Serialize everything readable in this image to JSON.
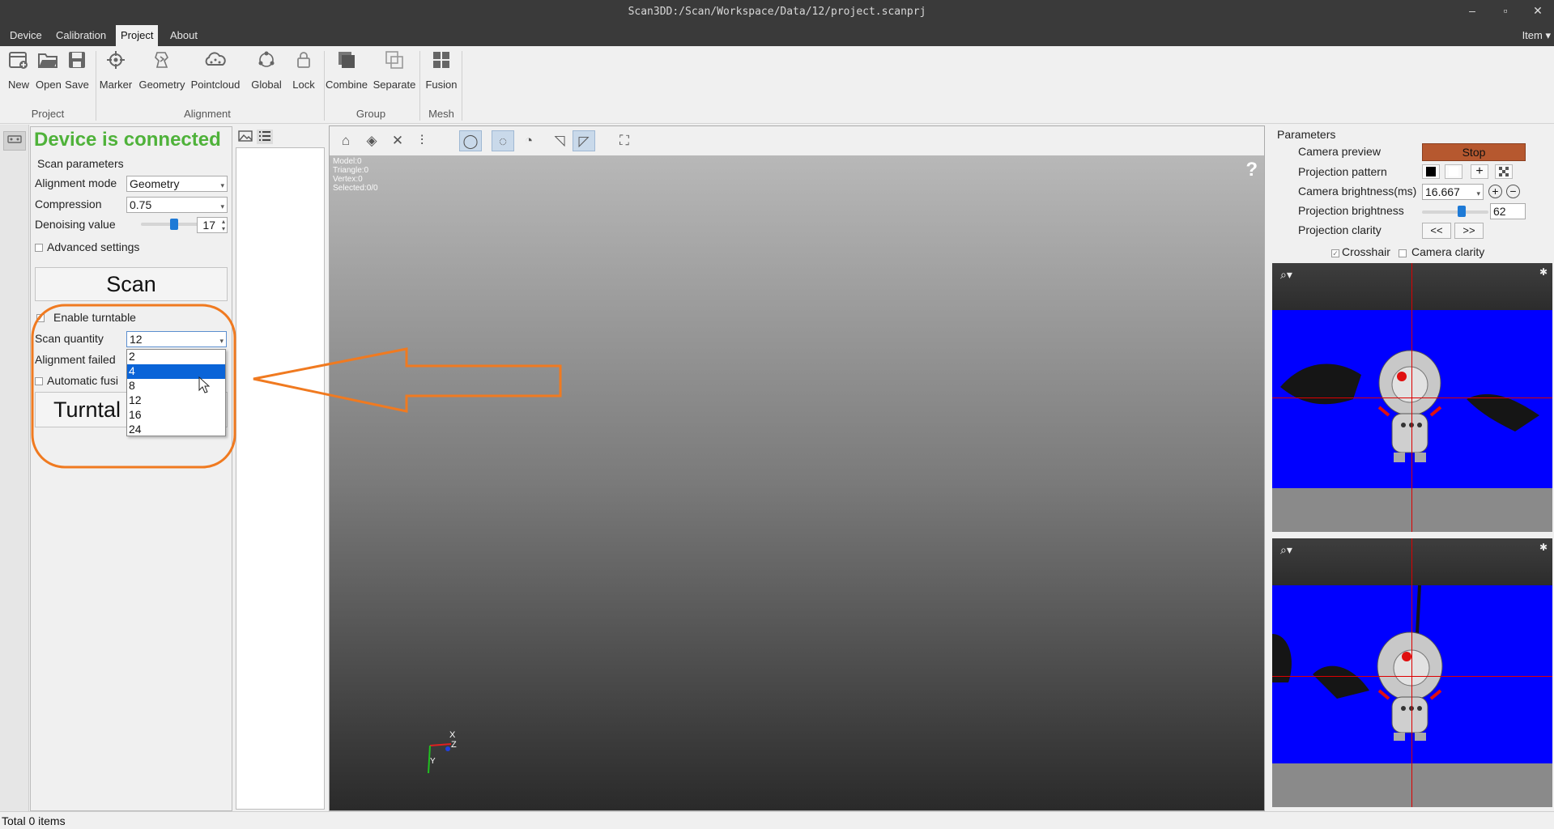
{
  "window": {
    "title": "Scan3DD:/Scan/Workspace/Data/12/project.scanprj",
    "controls": [
      "–",
      "▫",
      "✕"
    ]
  },
  "menu": {
    "items": [
      "Device",
      "Calibration",
      "Project",
      "About"
    ],
    "active": "Project",
    "right_label": "Item"
  },
  "toolbar": {
    "buttons": [
      {
        "label": "New",
        "icon": "new-project-icon"
      },
      {
        "label": "Open",
        "icon": "open-folder-icon"
      },
      {
        "label": "Save",
        "icon": "save-icon"
      },
      {
        "label": "Marker",
        "icon": "marker-icon"
      },
      {
        "label": "Geometry",
        "icon": "geometry-icon"
      },
      {
        "label": "Pointcloud",
        "icon": "pointcloud-icon"
      },
      {
        "label": "Global",
        "icon": "global-icon"
      },
      {
        "label": "Lock",
        "icon": "lock-icon"
      },
      {
        "label": "Combine",
        "icon": "combine-icon"
      },
      {
        "label": "Separate",
        "icon": "separate-icon"
      },
      {
        "label": "Fusion",
        "icon": "fusion-icon"
      }
    ],
    "groups": [
      "Project",
      "Alignment",
      "Group",
      "Mesh"
    ]
  },
  "scan_panel": {
    "status": "Device is connected",
    "status_color": "#4fb23a",
    "section_title": "Scan parameters",
    "alignment_mode_label": "Alignment mode",
    "alignment_mode_value": "Geometry",
    "compression_label": "Compression",
    "compression_value": "0.75",
    "denoising_label": "Denoising value",
    "denoising_value": "17",
    "advanced_label": "Advanced settings",
    "scan_button": "Scan",
    "turntable_enable_label": "Enable turntable",
    "scan_quantity_label": "Scan quantity",
    "scan_quantity_value": "12",
    "alignment_failed_label": "Alignment failed",
    "automatic_fusion_label": "Automatic fusi",
    "turntable_button": "Turntal",
    "dropdown_options": [
      "2",
      "4",
      "8",
      "12",
      "16",
      "24"
    ],
    "dropdown_selected": "4"
  },
  "viewport": {
    "info": [
      "Model:0",
      "Triangle:0",
      "Vertex:0",
      "Selected:0/0"
    ],
    "help": "?",
    "axes": {
      "x": "X",
      "y": "Y",
      "z": "Z"
    },
    "tools": [
      "home-icon",
      "layers-icon",
      "tools-icon",
      "mirror-icon",
      "circle-select-icon",
      "lasso-icon",
      "lasso-add-icon",
      "select-arrow-icon",
      "select-active-icon",
      "bounding-box-icon"
    ],
    "active_tools": [
      "circle-select-icon",
      "lasso-icon",
      "select-active-icon"
    ]
  },
  "params": {
    "title": "Parameters",
    "camera_preview_label": "Camera preview",
    "stop_button": "Stop",
    "stop_color": "#b6582f",
    "projection_pattern_label": "Projection pattern",
    "camera_brightness_label": "Camera brightness(ms)",
    "camera_brightness_value": "16.667",
    "projection_brightness_label": "Projection brightness",
    "projection_brightness_value": "62",
    "projection_clarity_label": "Projection clarity",
    "clarity_prev": "<<",
    "clarity_next": ">>",
    "crosshair_label": "Crosshair",
    "camera_clarity_label": "Camera clarity",
    "preview_background": "#0000ff"
  },
  "status_bar": {
    "text": "Total 0 items"
  }
}
